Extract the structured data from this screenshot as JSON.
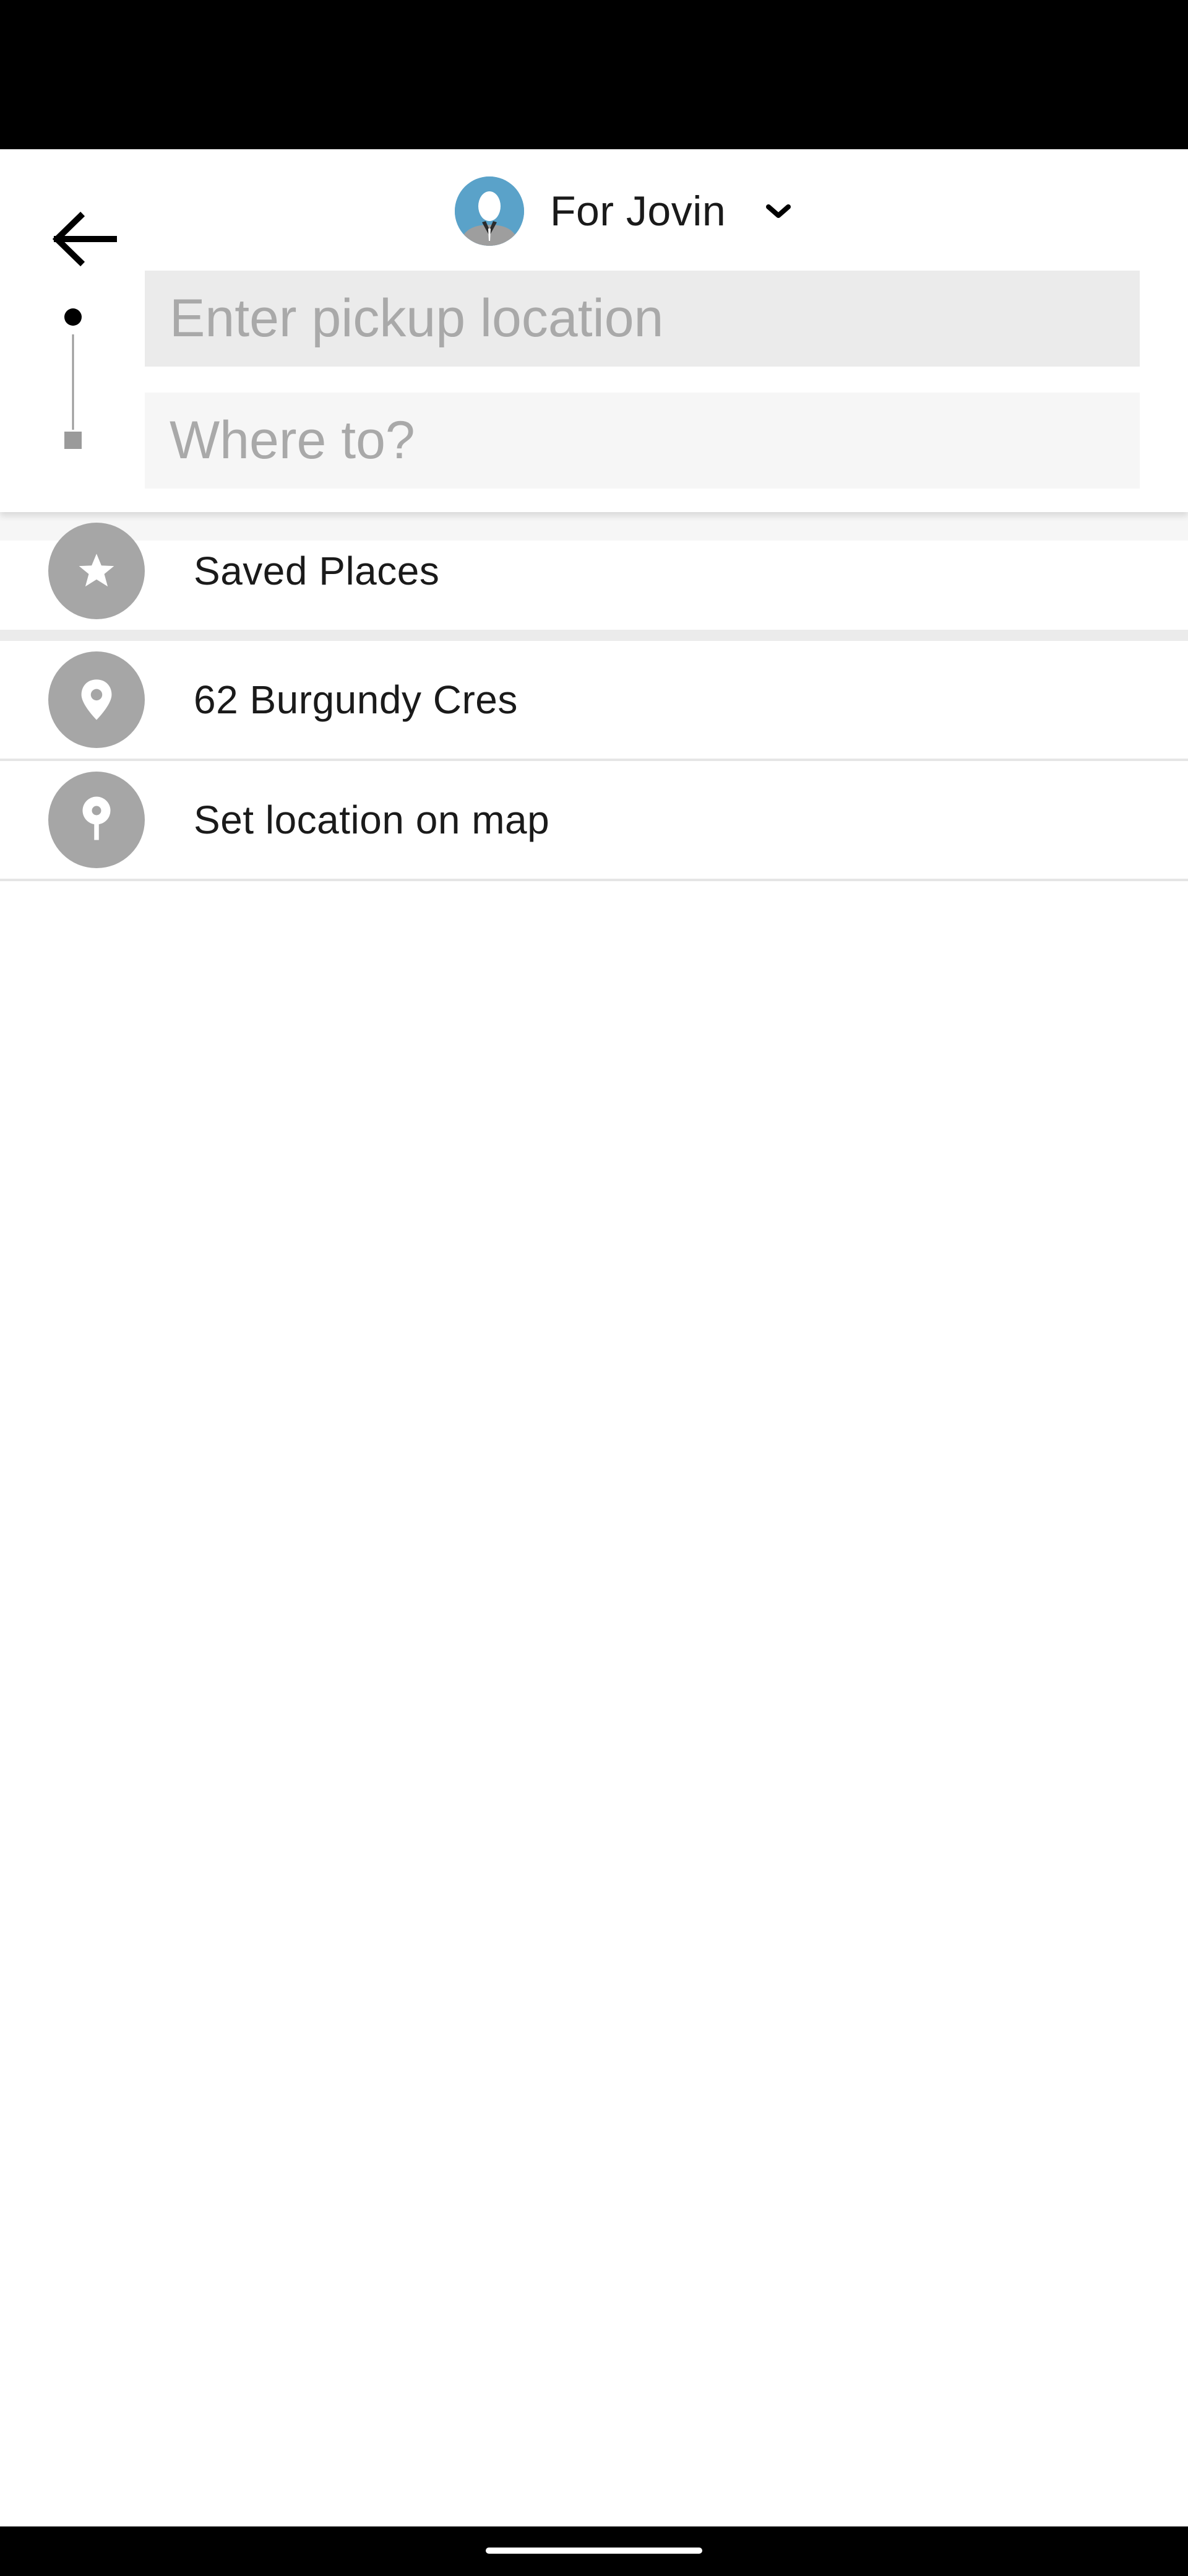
{
  "header": {
    "rider_label": "For Jovin",
    "back_icon": "arrow-left-icon",
    "chevron_icon": "chevron-down-icon"
  },
  "search": {
    "pickup_placeholder": "Enter pickup location",
    "pickup_value": "",
    "destination_placeholder": "Where to?",
    "destination_value": ""
  },
  "list": {
    "items": [
      {
        "label": "Saved Places",
        "icon": "star-icon"
      },
      {
        "label": "62 Burgundy Cres",
        "icon": "location-pin-icon"
      },
      {
        "label": "Set location on map",
        "icon": "map-pin-icon"
      }
    ]
  },
  "colors": {
    "icon_circle": "#a6a6a6",
    "pickup_bg": "#ebebeb",
    "destination_bg": "#f6f6f6",
    "avatar_bg": "#5aa2c9"
  }
}
